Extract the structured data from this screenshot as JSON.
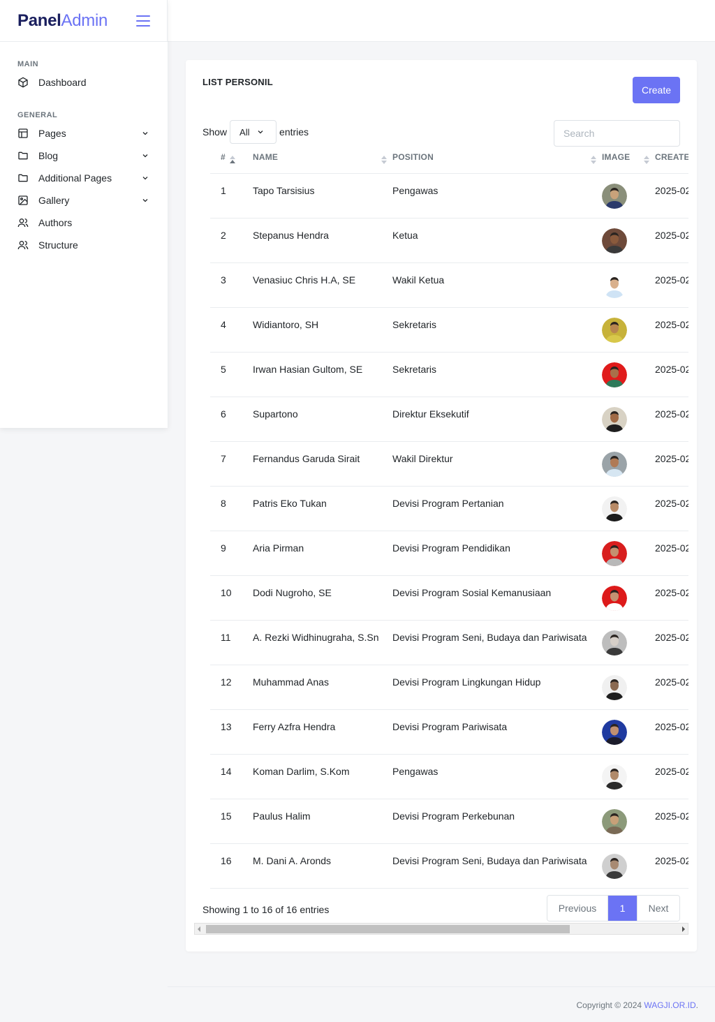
{
  "brand": {
    "part1": "Panel",
    "part2": "Admin"
  },
  "sidebar": {
    "sections": [
      {
        "title": "MAIN",
        "items": [
          {
            "label": "Dashboard",
            "icon": "cube-icon",
            "has_submenu": false
          }
        ]
      },
      {
        "title": "GENERAL",
        "items": [
          {
            "label": "Pages",
            "icon": "layout-icon",
            "has_submenu": true
          },
          {
            "label": "Blog",
            "icon": "folder-icon",
            "has_submenu": true
          },
          {
            "label": "Additional Pages",
            "icon": "folder-icon",
            "has_submenu": true
          },
          {
            "label": "Gallery",
            "icon": "image-icon",
            "has_submenu": true
          },
          {
            "label": "Authors",
            "icon": "users-icon",
            "has_submenu": false
          },
          {
            "label": "Structure",
            "icon": "users-icon",
            "has_submenu": false
          }
        ]
      }
    ]
  },
  "card": {
    "title": "LIST PERSONIL",
    "create_label": "Create",
    "show_label": "Show",
    "entries_value": "All",
    "entries_label": "entries",
    "search_placeholder": "Search"
  },
  "table": {
    "columns": [
      "#",
      "NAME",
      "POSITION",
      "IMAGE",
      "CREATED"
    ],
    "rows": [
      {
        "no": "1",
        "name": "Tapo Tarsisius",
        "position": "Pengawas",
        "created": "2025-02",
        "avatar": {
          "bg": "#8a8f7a",
          "face": "#c9a27a",
          "shirt": "#2b3a6b"
        }
      },
      {
        "no": "2",
        "name": "Stepanus Hendra",
        "position": "Ketua",
        "created": "2025-02",
        "avatar": {
          "bg": "#6e4a3a",
          "face": "#8a5a3c",
          "shirt": "#3a3a3a"
        }
      },
      {
        "no": "3",
        "name": "Venasiuc Chris H.A, SE",
        "position": "Wakil Ketua",
        "created": "2025-02",
        "avatar": {
          "bg": "#ffffff",
          "face": "#d9b08c",
          "shirt": "#cfe3f5"
        }
      },
      {
        "no": "4",
        "name": "Widiantoro, SH",
        "position": "Sekretaris",
        "created": "2025-02",
        "avatar": {
          "bg": "#c7b23a",
          "face": "#b8864f",
          "shirt": "#d8c84a"
        }
      },
      {
        "no": "5",
        "name": "Irwan Hasian Gultom, SE",
        "position": "Sekretaris",
        "created": "2025-02",
        "avatar": {
          "bg": "#e01b1b",
          "face": "#a8704a",
          "shirt": "#2e7a5a"
        }
      },
      {
        "no": "6",
        "name": "Supartono",
        "position": "Direktur Eksekutif",
        "created": "2025-02",
        "avatar": {
          "bg": "#d8d2c4",
          "face": "#a06a45",
          "shirt": "#1e1e1e"
        }
      },
      {
        "no": "7",
        "name": "Fernandus Garuda Sirait",
        "position": "Wakil Direktur",
        "created": "2025-02",
        "avatar": {
          "bg": "#9aa3a8",
          "face": "#b07a55",
          "shirt": "#d6e6f2"
        }
      },
      {
        "no": "8",
        "name": "Patris Eko Tukan",
        "position": "Devisi Program Pertanian",
        "created": "2025-02",
        "avatar": {
          "bg": "#f2f2f2",
          "face": "#b88a66",
          "shirt": "#1a1a1a"
        }
      },
      {
        "no": "9",
        "name": "Aria Pirman",
        "position": "Devisi Program Pendidikan",
        "created": "2025-02",
        "avatar": {
          "bg": "#d81e1e",
          "face": "#c49070",
          "shirt": "#b8b8b8"
        }
      },
      {
        "no": "10",
        "name": "Dodi Nugroho, SE",
        "position": "Devisi Program Sosial Kemanusiaan",
        "created": "2025-02",
        "avatar": {
          "bg": "#dd1a1a",
          "face": "#c49272",
          "shirt": "#ffffff"
        }
      },
      {
        "no": "11",
        "name": "A. Rezki Widhinugraha, S.Sn",
        "position": "Devisi Program Seni, Budaya dan Pariwisata",
        "created": "2025-02",
        "avatar": {
          "bg": "#bdbdbd",
          "face": "#d6cfc8",
          "shirt": "#3a3a3a"
        }
      },
      {
        "no": "12",
        "name": "Muhammad Anas",
        "position": "Devisi Program Lingkungan Hidup",
        "created": "2025-02",
        "avatar": {
          "bg": "#f0f0f0",
          "face": "#8a6a52",
          "shirt": "#1e1e1e"
        }
      },
      {
        "no": "13",
        "name": "Ferry Azfra Hendra",
        "position": "Devisi Program Pariwisata",
        "created": "2025-02",
        "avatar": {
          "bg": "#1f3aa0",
          "face": "#c09070",
          "shirt": "#1b1b2a"
        }
      },
      {
        "no": "14",
        "name": "Koman Darlim, S.Kom",
        "position": "Pengawas",
        "created": "2025-02",
        "avatar": {
          "bg": "#f4f4f4",
          "face": "#b08a6a",
          "shirt": "#2a2a2a"
        }
      },
      {
        "no": "15",
        "name": "Paulus Halim",
        "position": "Devisi Program Perkebunan",
        "created": "2025-02",
        "avatar": {
          "bg": "#8c9a7a",
          "face": "#c8a078",
          "shirt": "#7a6a55"
        }
      },
      {
        "no": "16",
        "name": "M. Dani A. Aronds",
        "position": "Devisi Program Seni, Budaya dan Pariwisata",
        "created": "2025-02",
        "avatar": {
          "bg": "#cfcfcf",
          "face": "#a88a72",
          "shirt": "#3a3a3a"
        }
      }
    ]
  },
  "footer_table": {
    "info": "Showing 1 to 16 of 16 entries",
    "previous": "Previous",
    "current_page": "1",
    "next": "Next"
  },
  "footer": {
    "copyright": "Copyright © 2024 ",
    "site": "WAGJI.OR.ID",
    "suffix": "."
  },
  "colors": {
    "accent": "#6b73f4",
    "brand_dark": "#1a1f5e"
  }
}
